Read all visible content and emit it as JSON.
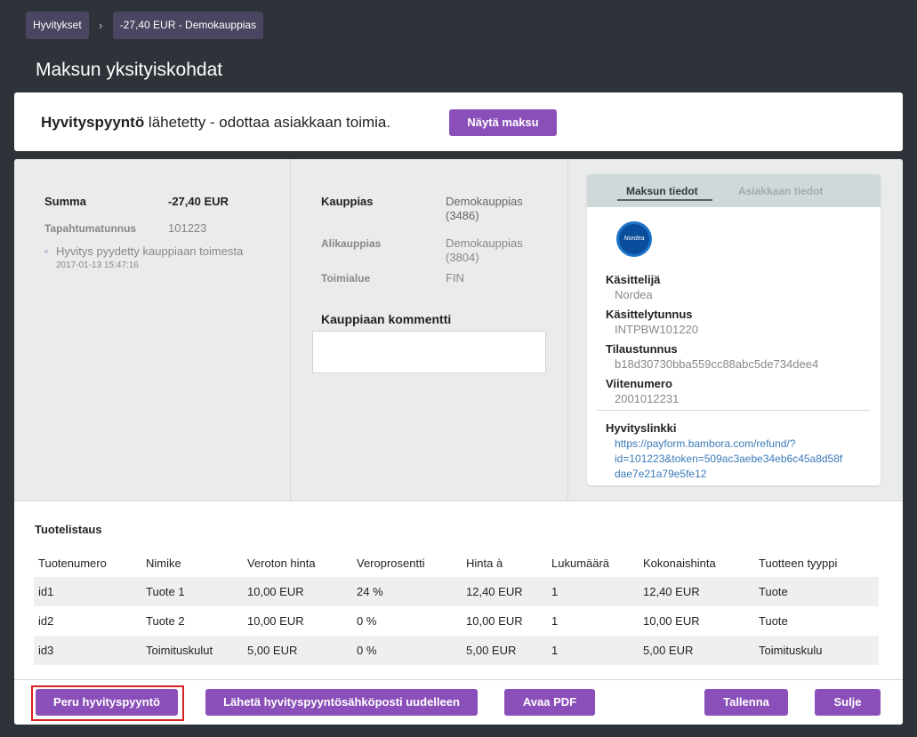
{
  "breadcrumb": {
    "items": [
      "Hyvitykset",
      "-27,40 EUR - Demokauppias"
    ],
    "separator": "›"
  },
  "page_title": "Maksun yksityiskohdat",
  "status": {
    "bold": "Hyvityspyyntö",
    "text": " lähetetty - odottaa asiakkaan toimia.",
    "show_payment_button": "Näytä maksu"
  },
  "summary": {
    "amount_label": "Summa",
    "amount_value": "-27,40 EUR",
    "transaction_label": "Tapahtumatunnus",
    "transaction_value": "101223",
    "event_text": "Hyvitys pyydetty kauppiaan toimesta",
    "event_time": "2017-01-13 15:47:16"
  },
  "merchant": {
    "merchant_label": "Kauppias",
    "merchant_value_line1": "Demokauppias",
    "merchant_value_line2": "(3486)",
    "submerchant_label": "Alikauppias",
    "submerchant_value_line1": "Demokauppias",
    "submerchant_value_line2": "(3804)",
    "industry_label": "Toimialue",
    "industry_value": "FIN",
    "comment_title": "Kauppiaan kommentti",
    "comment_value": ""
  },
  "info": {
    "tab_payment": "Maksun tiedot",
    "tab_customer": "Asiakkaan tiedot",
    "logo_text": "Nordea",
    "handler_label": "Käsittelijä",
    "handler_value": "Nordea",
    "handler_id_label": "Käsittelytunnus",
    "handler_id_value": "INTPBW101220",
    "order_label": "Tilaustunnus",
    "order_value": "b18d30730bba559cc88abc5de734dee4",
    "reference_label": "Viitenumero",
    "reference_value": "2001012231",
    "refund_link_label": "Hyvityslinkki",
    "refund_link_line1": "https://payform.bambora.com/refund/?",
    "refund_link_line2": "id=101223&token=509ac3aebe34eb6c45a8d58f",
    "refund_link_line3": "dae7e21a79e5fe12"
  },
  "products": {
    "title": "Tuotelistaus",
    "headers": [
      "Tuotenumero",
      "Nimike",
      "Veroton hinta",
      "Veroprosentti",
      "Hinta à",
      "Lukumäärä",
      "Kokonaishinta",
      "Tuotteen tyyppi"
    ],
    "rows": [
      [
        "id1",
        "Tuote 1",
        "10,00 EUR",
        "24 %",
        "12,40 EUR",
        "1",
        "12,40 EUR",
        "Tuote"
      ],
      [
        "id2",
        "Tuote 2",
        "10,00 EUR",
        "0 %",
        "10,00 EUR",
        "1",
        "10,00 EUR",
        "Tuote"
      ],
      [
        "id3",
        "Toimituskulut",
        "5,00 EUR",
        "0 %",
        "5,00 EUR",
        "1",
        "5,00 EUR",
        "Toimituskulu"
      ]
    ]
  },
  "footer": {
    "cancel": "Peru hyvityspyyntö",
    "resend": "Lähetä hyvityspyyntösähköposti uudelleen",
    "open_pdf": "Avaa PDF",
    "save": "Tallenna",
    "close": "Sulje"
  },
  "colors": {
    "accent": "#8a4fb8",
    "background": "#2d3339",
    "link": "#3a7ab8",
    "highlight_outline": "#d92020"
  }
}
